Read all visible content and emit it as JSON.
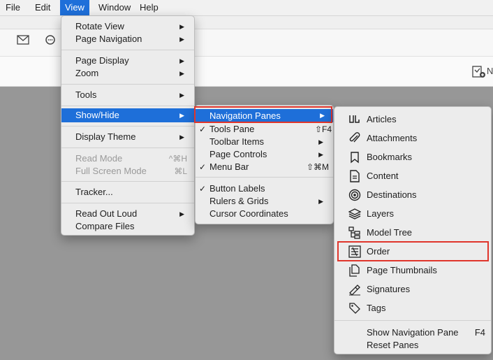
{
  "menubar": {
    "items": [
      {
        "label": "File"
      },
      {
        "label": "Edit"
      },
      {
        "label": "View"
      },
      {
        "label": "Window"
      },
      {
        "label": "Help"
      }
    ]
  },
  "toolbar": {
    "mail_icon": "envelope-icon",
    "zoom_icon": "zoom-icon",
    "right_button_text": "N",
    "right_icon": "edit-document-icon"
  },
  "view_menu": {
    "rotate_view": "Rotate View",
    "page_navigation": "Page Navigation",
    "page_display": "Page Display",
    "zoom": "Zoom",
    "tools": "Tools",
    "show_hide": "Show/Hide",
    "display_theme": "Display Theme",
    "read_mode": "Read Mode",
    "read_mode_sc": "^⌘H",
    "full_screen_mode": "Full Screen Mode",
    "full_screen_sc": "⌘L",
    "tracker": "Tracker...",
    "read_out_loud": "Read Out Loud",
    "compare_files": "Compare Files"
  },
  "show_hide_menu": {
    "navigation_panes": "Navigation Panes",
    "tools_pane": "Tools Pane",
    "tools_pane_sc": "⇧F4",
    "toolbar_items": "Toolbar Items",
    "page_controls": "Page Controls",
    "menu_bar": "Menu Bar",
    "menu_bar_sc": "⇧⌘M",
    "button_labels": "Button Labels",
    "rulers_grids": "Rulers & Grids",
    "cursor_coordinates": "Cursor Coordinates",
    "check": "✓"
  },
  "nav_panes_menu": {
    "items": [
      {
        "label": "Articles",
        "icon": "articles-icon"
      },
      {
        "label": "Attachments",
        "icon": "paperclip-icon"
      },
      {
        "label": "Bookmarks",
        "icon": "bookmark-icon"
      },
      {
        "label": "Content",
        "icon": "content-icon"
      },
      {
        "label": "Destinations",
        "icon": "destinations-icon"
      },
      {
        "label": "Layers",
        "icon": "layers-icon"
      },
      {
        "label": "Model Tree",
        "icon": "model-tree-icon"
      },
      {
        "label": "Order",
        "icon": "order-icon"
      },
      {
        "label": "Page Thumbnails",
        "icon": "page-thumbnails-icon"
      },
      {
        "label": "Signatures",
        "icon": "signature-icon"
      },
      {
        "label": "Tags",
        "icon": "tag-icon"
      }
    ],
    "show_navigation_pane": "Show Navigation Pane",
    "show_navigation_pane_sc": "F4",
    "reset_panes": "Reset Panes"
  },
  "colors": {
    "highlight": "#1e6fd9",
    "annotation_red": "#e0352b",
    "canvas_gray": "#979797"
  }
}
